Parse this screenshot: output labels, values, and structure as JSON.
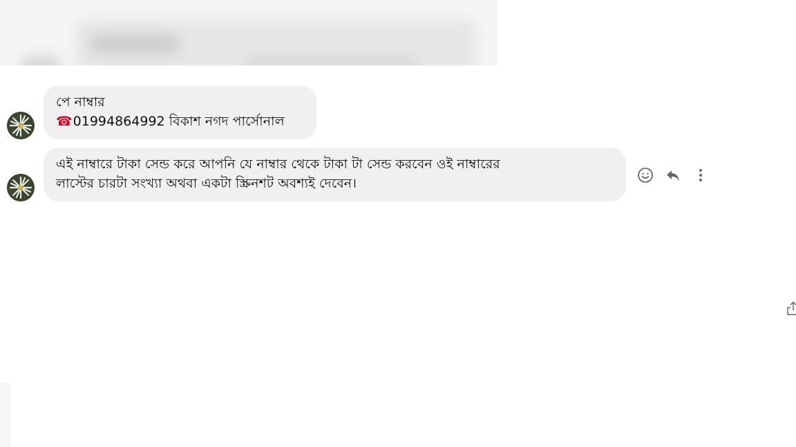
{
  "conversation": {
    "messages": [
      {
        "lines": [
          "পে নাম্বার"
        ],
        "phone_line": {
          "icon": "telephone-icon",
          "text": "01994864992 বিকাশ নগদ পার্সোনাল"
        }
      },
      {
        "lines": [
          "এই নাম্বারে টাকা সেন্ড করে আপনি যে নাম্বার থেকে টাকা টা সেন্ড করবেন ওই নাম্বারের",
          "লাস্টের চারটা সংখ্যা অথবা একটা স্ক্রিনশট অবশ্যই দেবেন।"
        ]
      }
    ]
  },
  "message_actions": {
    "icons": [
      "smiley-react-icon",
      "reply-icon",
      "more-options-icon"
    ]
  },
  "colors": {
    "bubble": "#f0f0f0",
    "text": "#111111",
    "icon": "#606770",
    "phone_icon": "#c8102e"
  }
}
